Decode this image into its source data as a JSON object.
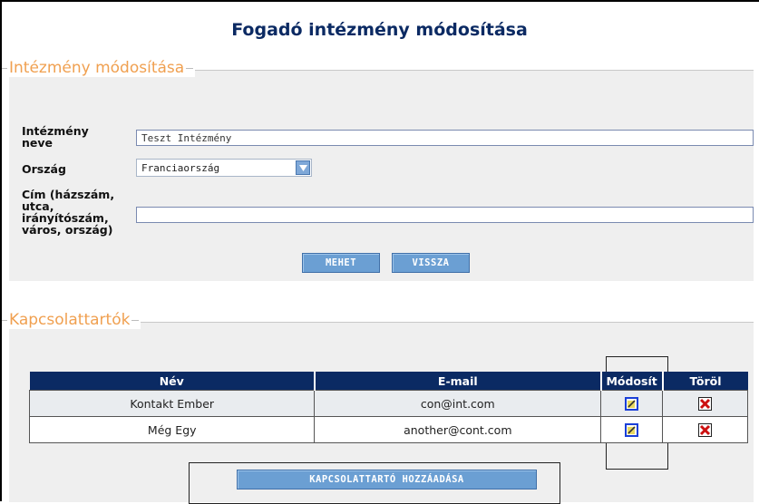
{
  "page": {
    "title": "Fogadó intézmény módosítása"
  },
  "institution_section": {
    "legend": "Intézmény módosítása",
    "name_label": [
      "Intézmény",
      "neve"
    ],
    "name_value": "Teszt Intézmény",
    "country_label": "Ország",
    "country_selected": "Franciaország",
    "address_label": [
      "Cím (házszám,",
      "utca,",
      "irányítószám,",
      "város, ország)"
    ],
    "address_value": "",
    "submit_label": "MEHET",
    "back_label": "VISSZA"
  },
  "contacts_section": {
    "legend": "Kapcsolattartók",
    "columns": [
      "Név",
      "E-mail",
      "Módosít",
      "Töröl"
    ],
    "rows": [
      {
        "name": "Kontakt Ember",
        "email": "con@int.com"
      },
      {
        "name": "Még Egy",
        "email": "another@cont.com"
      }
    ],
    "add_label": "KAPCSOLATTARTÓ HOZZÁADÁSA"
  },
  "icons": {
    "edit": "edit-icon",
    "delete": "delete-icon",
    "dropdown": "chevron-down-icon"
  },
  "colors": {
    "header_bg": "#0b2a63",
    "legend": "#f0a050",
    "button": "#6b9fd3"
  }
}
